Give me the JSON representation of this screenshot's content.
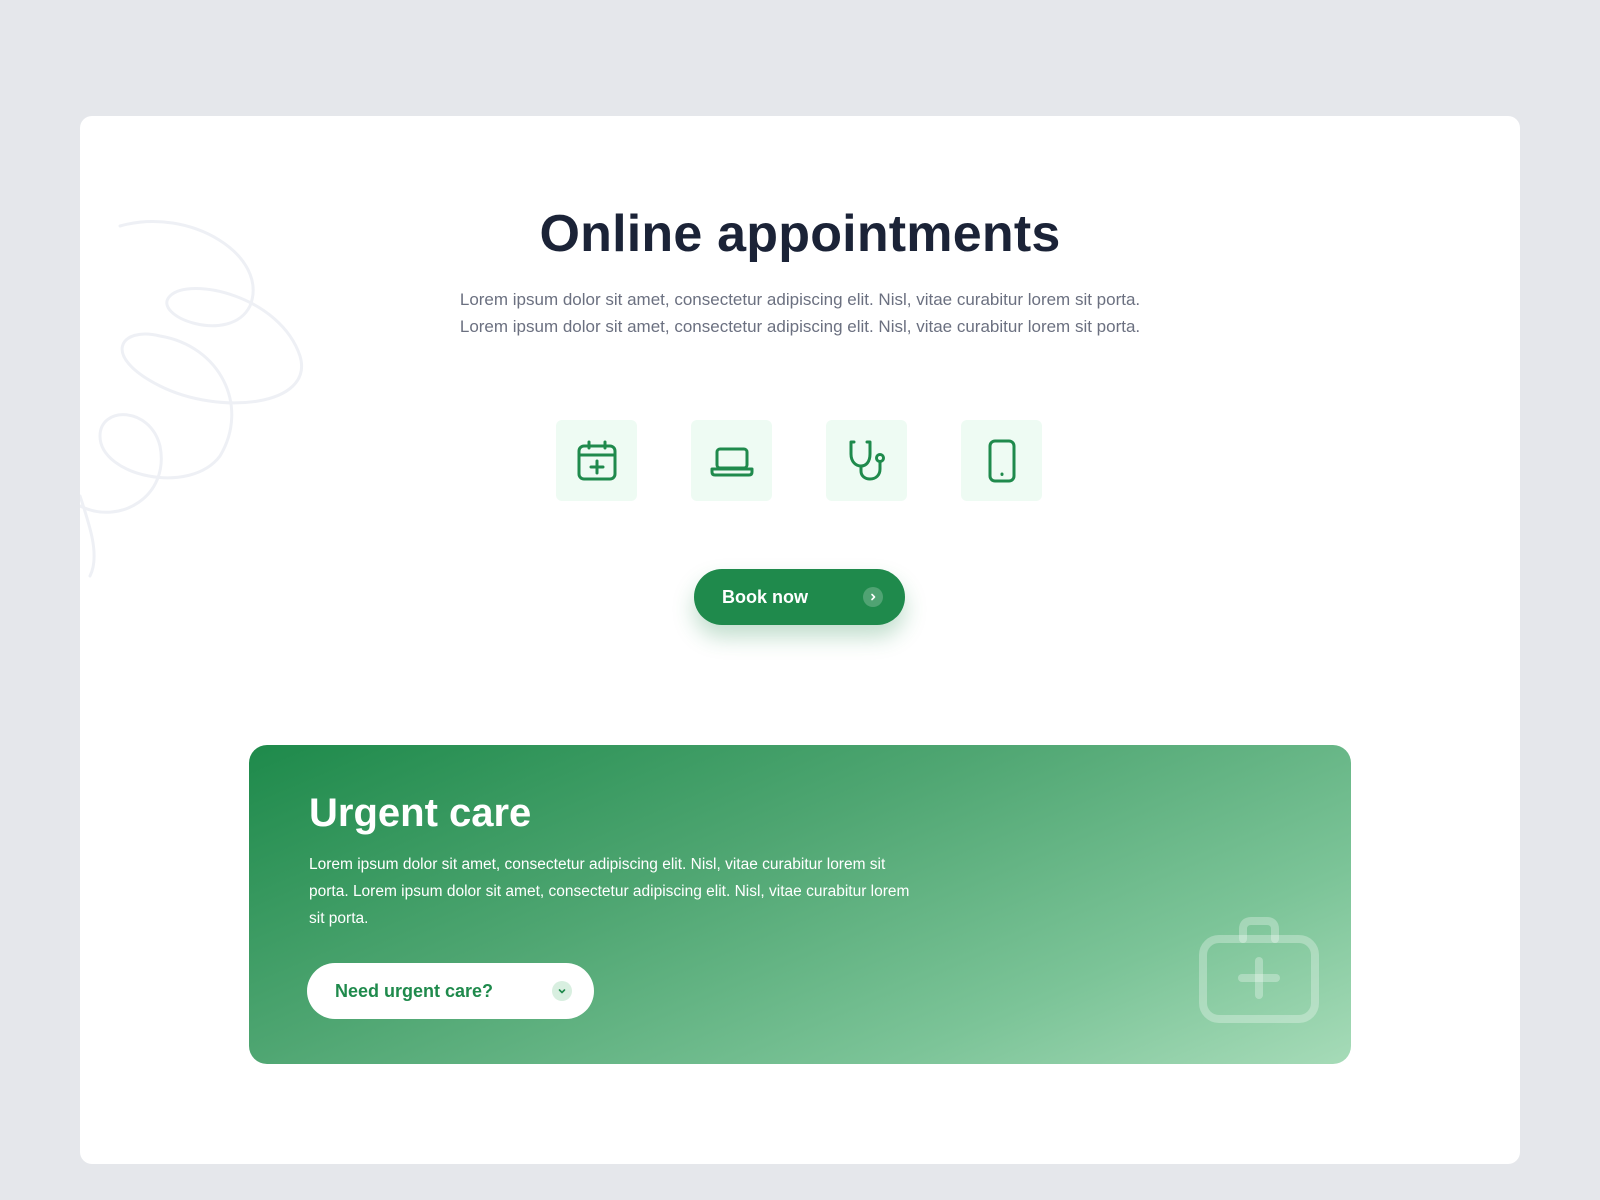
{
  "hero": {
    "title": "Online appointments",
    "description": "Lorem ipsum dolor sit amet, consectetur adipiscing elit. Nisl, vitae curabitur lorem sit porta. Lorem ipsum dolor sit amet, consectetur adipiscing elit. Nisl, vitae curabitur lorem sit porta."
  },
  "icons": [
    {
      "name": "calendar-plus-icon"
    },
    {
      "name": "laptop-icon"
    },
    {
      "name": "stethoscope-icon"
    },
    {
      "name": "smartphone-icon"
    }
  ],
  "book_button": {
    "label": "Book now",
    "icon": "chevron-right-icon"
  },
  "urgent": {
    "title": "Urgent care",
    "description": "Lorem ipsum dolor sit amet, consectetur adipiscing elit. Nisl, vitae curabitur lorem sit porta. Lorem ipsum dolor sit amet, consectetur adipiscing elit. Nisl, vitae curabitur lorem sit porta.",
    "button_label": "Need urgent care?",
    "button_icon": "chevron-down-icon",
    "decor_icon": "first-aid-kit-icon"
  },
  "colors": {
    "page_bg": "#e5e7eb",
    "card_bg": "#ffffff",
    "primary": "#1f8a4c",
    "heading": "#1b2337",
    "body_text": "#6b7080",
    "icon_tile_bg": "#eefbf3"
  }
}
